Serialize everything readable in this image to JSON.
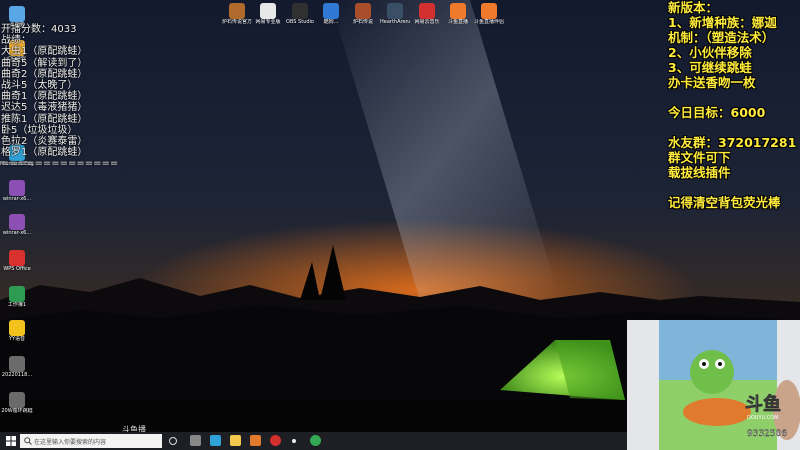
{
  "desktop_left": [
    {
      "label": "此电脑",
      "color": "#5aa7e6",
      "icon": "computer-icon"
    },
    {
      "label": "QQ游戏",
      "color": "#f2b134",
      "icon": "qq-game-icon"
    },
    {
      "label": "Microsoft Edge",
      "color": "#2fa3d8",
      "icon": "edge-icon"
    },
    {
      "label": "winrar-x6...",
      "color": "#8c4fb3",
      "icon": "winrar-icon"
    },
    {
      "label": "winrar-x6...",
      "color": "#8c4fb3",
      "icon": "winrar-icon"
    },
    {
      "label": "WPS Office",
      "color": "#d9322e",
      "icon": "wps-icon"
    },
    {
      "label": "工作簿1",
      "color": "#2e9b53",
      "icon": "spreadsheet-icon"
    },
    {
      "label": "YY语音",
      "color": "#f3c21c",
      "icon": "yy-icon"
    },
    {
      "label": "20220118...",
      "color": "#6b6b6b",
      "icon": "file-icon"
    },
    {
      "label": "20W循环跳蛙",
      "color": "#6b6b6b",
      "icon": "file-icon"
    }
  ],
  "desktop_top": [
    {
      "label": "炉石传说官方插件",
      "color": "#b06a2c",
      "icon": "hearthstone-plugin-icon"
    },
    {
      "label": "网易专业版",
      "color": "#e8e8e8",
      "icon": "netease-icon"
    },
    {
      "label": "OBS Studio",
      "color": "#303030",
      "icon": "obs-icon"
    },
    {
      "label": "酷狗... ",
      "color": "#2f78d6",
      "icon": "kugou-icon"
    },
    {
      "label": "炉石传说",
      "color": "#a84e2a",
      "icon": "hearthstone-icon"
    },
    {
      "label": "HearthArena 快捷方式",
      "color": "#3a4f66",
      "icon": "hearth-arena-icon"
    },
    {
      "label": "网易云音乐",
      "color": "#d22f2f",
      "icon": "music-icon"
    },
    {
      "label": "斗鱼直播",
      "color": "#f07a2c",
      "icon": "douyu-icon"
    },
    {
      "label": "斗鱼直播伴侣",
      "color": "#f07a2c",
      "icon": "douyu-partner-icon"
    }
  ],
  "left_overlay": [
    "开播分数：4033",
    "战绩：",
    "大虫1（原配跳蛙）",
    "曲奇5（解读到了）",
    "曲奇2（原配跳蛙）",
    "战斗5（太晚了）",
    "曲奇1（原配跳蛙）",
    "迟达5（毒液猪猪）",
    "推陈1（原配跳蛙）",
    "卧5（垃圾垃圾）",
    "色拉2（炎赛泰雷）",
    "格罗1（原配跳蛙）",
    "=============="
  ],
  "right_overlay": [
    "新版本：",
    "1、新增种族：娜迦",
    "机制：（塑造法术）",
    "2、小伙伴移除",
    "3、可继续跳蛙",
    "办卡送香吻一枚",
    "",
    "今日目标：6000",
    "",
    "水友群：372017281",
    "群文件可下",
    "载拔线插件",
    "",
    "记得清空背包荧光棒"
  ],
  "taskbar": {
    "search_placeholder": "在这里输入你要搜索的内容"
  },
  "stream": {
    "logo_text": "斗鱼",
    "logo_sub": "DOUYU.COM",
    "room_id": "9332506",
    "watermark": "斗鱼播"
  }
}
